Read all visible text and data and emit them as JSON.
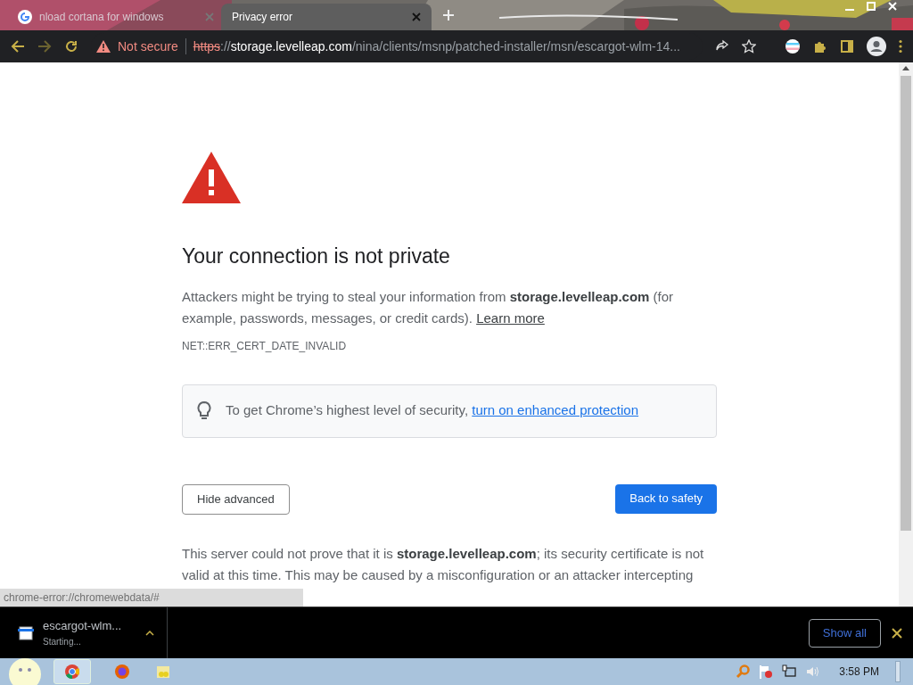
{
  "tabs": [
    {
      "title": "nload cortana for windows",
      "selected": false
    },
    {
      "title": "Privacy error",
      "selected": true
    }
  ],
  "toolbar": {
    "security_label": "Not secure",
    "url_scheme": "https",
    "url_separator": "://",
    "url_host": "storage.levelleap.com",
    "url_path": "/nina/clients/msnp/patched-installer/msn/escargot-wlm-14..."
  },
  "page": {
    "heading": "Your connection is not private",
    "intro": "Attackers might be trying to steal your information from **storage.levelleap.com** (for example, passwords, messages, or credit cards).",
    "learn_more": "Learn more",
    "error_code": "NET::ERR_CERT_DATE_INVALID",
    "tip": "To get Chrome’s highest level of security,",
    "tip_link": "turn on enhanced protection",
    "hide_advanced": "Hide advanced",
    "back_to_safety": "Back to safety",
    "details": "This server could not prove that it is **storage.levelleap.com**; its security certificate is not valid at this time. This may be caused by a misconfiguration or an attacker intercepting"
  },
  "status_bubble": "chrome-error://chromewebdata/#",
  "download": {
    "name": "escargot-wlm...",
    "status": "Starting...",
    "show_all": "Show all"
  },
  "taskbar": {
    "clock": "3:58 PM"
  }
}
